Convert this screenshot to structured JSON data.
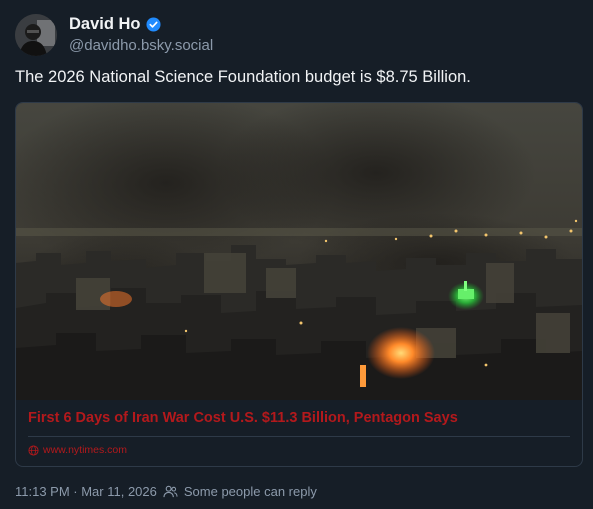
{
  "author": {
    "display_name": "David Ho",
    "handle": "@davidho.bsky.social"
  },
  "post": {
    "text": "The 2026 National Science Foundation budget is $8.75 Billion."
  },
  "link_card": {
    "title": "First 6 Days of Iran War Cost U.S. $11.3 Billion, Pentagon Says",
    "domain": "www.nytimes.com"
  },
  "meta": {
    "timestamp": "11:13 PM · Mar 11, 2026",
    "reply_setting": "Some people can reply"
  },
  "colors": {
    "background": "#161e27",
    "link_red": "#b3191c",
    "verified_blue": "#208bfe",
    "muted_text": "#8c9aab"
  },
  "icons": [
    "verified-badge-icon",
    "globe-icon",
    "people-icon"
  ]
}
